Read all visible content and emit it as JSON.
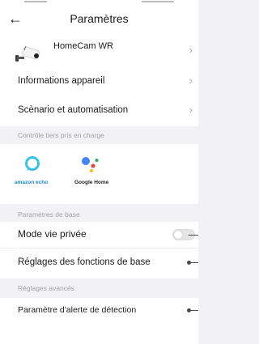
{
  "header": {
    "back_icon": "back-arrow-icon",
    "title": "Paramètres"
  },
  "device": {
    "name": "HomeCam WR",
    "icon": "security-camera-icon"
  },
  "rows": {
    "info": "Informations appareil",
    "scenario": "Scènario et automatisation"
  },
  "third_party": {
    "section_title": "Contrôle tiers pris en charge",
    "alexa_label": "amazon echo",
    "google_label": "Google Home"
  },
  "basic": {
    "section_title": "Paramètres de base",
    "privacy_mode": "Mode vie privée",
    "privacy_mode_on": false,
    "basic_functions": "Réglages des fonctions de base"
  },
  "advanced": {
    "section_title": "Réglages avancés",
    "detection_alert": "Paramètre d'alerte de détection"
  },
  "colors": {
    "alexa_ring": "#38c2e8",
    "google_blue": "#4285f4",
    "google_red": "#ea4335",
    "google_yellow": "#fbbc05",
    "google_green": "#34a853"
  }
}
